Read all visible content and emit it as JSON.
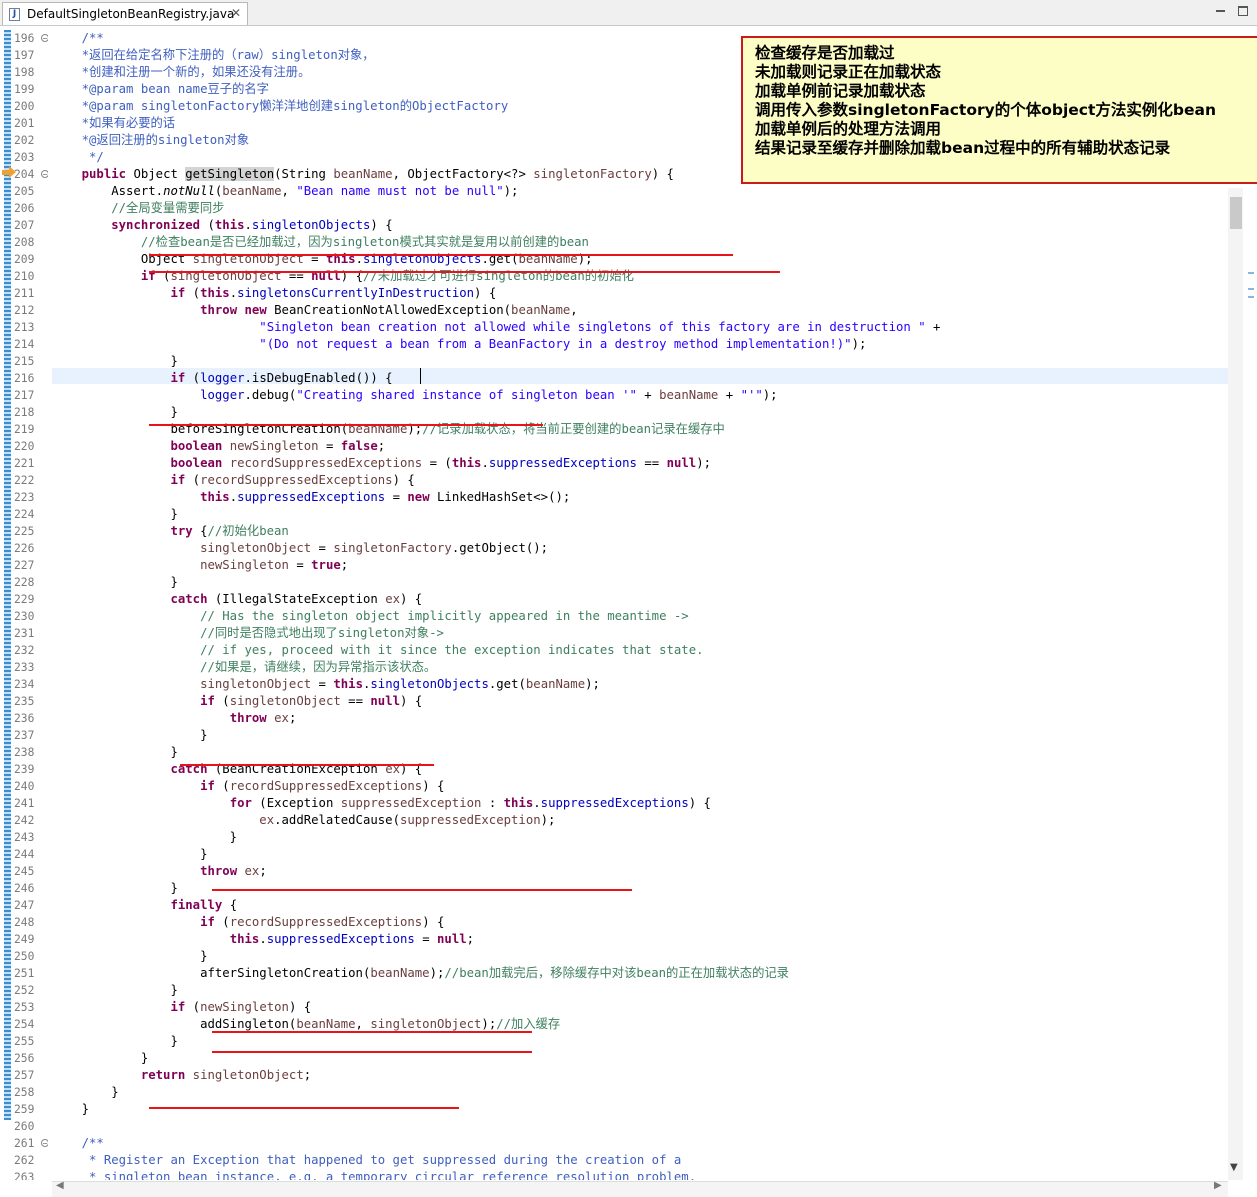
{
  "tab": {
    "icon": "java-file-icon",
    "title": "DefaultSingletonBeanRegistry.java",
    "close": "✕"
  },
  "window": {
    "minimize": "minimize-icon",
    "maximize": "maximize-icon"
  },
  "annotation": [
    "检查缓存是否加载过",
    "未加载则记录正在加载状态",
    "加载单例前记录加载状态",
    "调用传入参数singletonFactory的个体object方法实例化bean",
    "加载单例后的处理方法调用",
    "结果记录至缓存并删除加载bean过程中的所有辅助状态记录"
  ],
  "code": [
    {
      "n": "196",
      "fold": "minus",
      "t": [
        [
          "dc",
          "    /**"
        ]
      ]
    },
    {
      "n": "197",
      "t": [
        [
          "dc",
          "    *返回在给定名称下注册的（raw）singleton对象，"
        ]
      ]
    },
    {
      "n": "198",
      "t": [
        [
          "dc",
          "    *创建和注册一个新的，如果还没有注册。"
        ]
      ]
    },
    {
      "n": "199",
      "t": [
        [
          "dc",
          "    *@param bean name豆子的名字"
        ]
      ]
    },
    {
      "n": "200",
      "t": [
        [
          "dc",
          "    *@param singletonFactory懒洋洋地创建singleton的ObjectFactory"
        ]
      ]
    },
    {
      "n": "201",
      "t": [
        [
          "dc",
          "    *如果有必要的话"
        ]
      ]
    },
    {
      "n": "202",
      "t": [
        [
          "dc",
          "    *@返回注册的singleton对象"
        ]
      ]
    },
    {
      "n": "203",
      "t": [
        [
          "dc",
          "     */"
        ]
      ]
    },
    {
      "n": "204",
      "fold": "minus",
      "t": [
        [
          "",
          "    "
        ],
        [
          "kw",
          "public"
        ],
        [
          "",
          " Object "
        ],
        [
          "hl",
          "getSingleton"
        ],
        [
          "",
          "(String "
        ],
        [
          "lv",
          "beanName"
        ],
        [
          "",
          ", ObjectFactory<?> "
        ],
        [
          "lv",
          "singletonFactory"
        ],
        [
          "",
          ") {"
        ]
      ]
    },
    {
      "n": "205",
      "t": [
        [
          "",
          "        Assert."
        ],
        [
          "it",
          "notNull"
        ],
        [
          "",
          "("
        ],
        [
          "lv",
          "beanName"
        ],
        [
          "",
          ", "
        ],
        [
          "st",
          "\"Bean name must not be null\""
        ],
        [
          "",
          ");"
        ]
      ]
    },
    {
      "n": "206",
      "t": [
        [
          "cm",
          "        //全局变量需要同步"
        ]
      ]
    },
    {
      "n": "207",
      "t": [
        [
          "",
          "        "
        ],
        [
          "kw",
          "synchronized"
        ],
        [
          "",
          " ("
        ],
        [
          "kw",
          "this"
        ],
        [
          "",
          "."
        ],
        [
          "fd",
          "singletonObjects"
        ],
        [
          "",
          ") {"
        ]
      ]
    },
    {
      "n": "208",
      "t": [
        [
          "cm",
          "            //检查bean是否已经加载过，因为singleton模式其实就是复用以前创建的bean"
        ]
      ]
    },
    {
      "n": "209",
      "t": [
        [
          "",
          "            Object "
        ],
        [
          "lv",
          "singletonObject"
        ],
        [
          "",
          " = "
        ],
        [
          "kw",
          "this"
        ],
        [
          "",
          "."
        ],
        [
          "fd",
          "singletonObjects"
        ],
        [
          "",
          ".get("
        ],
        [
          "lv",
          "beanName"
        ],
        [
          "",
          ");"
        ]
      ]
    },
    {
      "n": "210",
      "t": [
        [
          "",
          "            "
        ],
        [
          "kw",
          "if"
        ],
        [
          "",
          " ("
        ],
        [
          "lv",
          "singletonObject"
        ],
        [
          "",
          " == "
        ],
        [
          "kw",
          "null"
        ],
        [
          "",
          ") {"
        ],
        [
          "cm",
          "//未加载过才可进行singleton的bean的初始化"
        ]
      ]
    },
    {
      "n": "211",
      "t": [
        [
          "",
          "                "
        ],
        [
          "kw",
          "if"
        ],
        [
          "",
          " ("
        ],
        [
          "kw",
          "this"
        ],
        [
          "",
          "."
        ],
        [
          "fd",
          "singletonsCurrentlyInDestruction"
        ],
        [
          "",
          ") {"
        ]
      ]
    },
    {
      "n": "212",
      "t": [
        [
          "",
          "                    "
        ],
        [
          "kw",
          "throw"
        ],
        [
          "",
          " "
        ],
        [
          "kw",
          "new"
        ],
        [
          "",
          " BeanCreationNotAllowedException("
        ],
        [
          "lv",
          "beanName"
        ],
        [
          "",
          ","
        ]
      ]
    },
    {
      "n": "213",
      "t": [
        [
          "",
          "                            "
        ],
        [
          "st",
          "\"Singleton bean creation not allowed while singletons of this factory are in destruction \""
        ],
        [
          "",
          " +"
        ]
      ]
    },
    {
      "n": "214",
      "t": [
        [
          "",
          "                            "
        ],
        [
          "st",
          "\"(Do not request a bean from a BeanFactory in a destroy method implementation!)\""
        ],
        [
          "",
          ");"
        ]
      ]
    },
    {
      "n": "215",
      "t": [
        [
          "",
          "                }"
        ]
      ]
    },
    {
      "n": "216",
      "t": [
        [
          "",
          "                "
        ],
        [
          "kw",
          "if"
        ],
        [
          "",
          " ("
        ],
        [
          "fd",
          "logger"
        ],
        [
          "",
          ".isDebugEnabled()) {"
        ]
      ]
    },
    {
      "n": "217",
      "t": [
        [
          "",
          "                    "
        ],
        [
          "fd",
          "logger"
        ],
        [
          "",
          ".debug("
        ],
        [
          "st",
          "\"Creating shared instance of singleton bean '\""
        ],
        [
          "",
          " + "
        ],
        [
          "lv",
          "beanName"
        ],
        [
          "",
          " + "
        ],
        [
          "st",
          "\"'\""
        ],
        [
          "",
          ");"
        ]
      ]
    },
    {
      "n": "218",
      "t": [
        [
          "",
          "                }"
        ]
      ]
    },
    {
      "n": "219",
      "t": [
        [
          "",
          "                beforeSingletonCreation("
        ],
        [
          "lv",
          "beanName"
        ],
        [
          "",
          ");"
        ],
        [
          "cm",
          "//记录加载状态，将当前正要创建的bean记录在缓存中"
        ]
      ]
    },
    {
      "n": "220",
      "t": [
        [
          "",
          "                "
        ],
        [
          "kw",
          "boolean"
        ],
        [
          "",
          " "
        ],
        [
          "lv",
          "newSingleton"
        ],
        [
          "",
          " = "
        ],
        [
          "kw",
          "false"
        ],
        [
          "",
          ";"
        ]
      ]
    },
    {
      "n": "221",
      "t": [
        [
          "",
          "                "
        ],
        [
          "kw",
          "boolean"
        ],
        [
          "",
          " "
        ],
        [
          "lv",
          "recordSuppressedExceptions"
        ],
        [
          "",
          " = ("
        ],
        [
          "kw",
          "this"
        ],
        [
          "",
          "."
        ],
        [
          "fd",
          "suppressedExceptions"
        ],
        [
          "",
          " == "
        ],
        [
          "kw",
          "null"
        ],
        [
          "",
          ");"
        ]
      ]
    },
    {
      "n": "222",
      "t": [
        [
          "",
          "                "
        ],
        [
          "kw",
          "if"
        ],
        [
          "",
          " ("
        ],
        [
          "lv",
          "recordSuppressedExceptions"
        ],
        [
          "",
          ") {"
        ]
      ]
    },
    {
      "n": "223",
      "t": [
        [
          "",
          "                    "
        ],
        [
          "kw",
          "this"
        ],
        [
          "",
          "."
        ],
        [
          "fd",
          "suppressedExceptions"
        ],
        [
          "",
          " = "
        ],
        [
          "kw",
          "new"
        ],
        [
          "",
          " LinkedHashSet<>();"
        ]
      ]
    },
    {
      "n": "224",
      "t": [
        [
          "",
          "                }"
        ]
      ]
    },
    {
      "n": "225",
      "t": [
        [
          "",
          "                "
        ],
        [
          "kw",
          "try"
        ],
        [
          "",
          " {"
        ],
        [
          "cm",
          "//初始化bean"
        ]
      ]
    },
    {
      "n": "226",
      "t": [
        [
          "",
          "                    "
        ],
        [
          "lv",
          "singletonObject"
        ],
        [
          "",
          " = "
        ],
        [
          "lv",
          "singletonFactory"
        ],
        [
          "",
          ".getObject();"
        ]
      ]
    },
    {
      "n": "227",
      "t": [
        [
          "",
          "                    "
        ],
        [
          "lv",
          "newSingleton"
        ],
        [
          "",
          " = "
        ],
        [
          "kw",
          "true"
        ],
        [
          "",
          ";"
        ]
      ]
    },
    {
      "n": "228",
      "t": [
        [
          "",
          "                }"
        ]
      ]
    },
    {
      "n": "229",
      "t": [
        [
          "",
          "                "
        ],
        [
          "kw",
          "catch"
        ],
        [
          "",
          " (IllegalStateException "
        ],
        [
          "lv",
          "ex"
        ],
        [
          "",
          ") {"
        ]
      ]
    },
    {
      "n": "230",
      "t": [
        [
          "cm",
          "                    // Has the singleton object implicitly appeared in the meantime ->"
        ]
      ]
    },
    {
      "n": "231",
      "t": [
        [
          "cm",
          "                    //同时是否隐式地出现了singleton对象->"
        ]
      ]
    },
    {
      "n": "232",
      "t": [
        [
          "cm",
          "                    // if yes, proceed with it since the exception indicates that state."
        ]
      ]
    },
    {
      "n": "233",
      "t": [
        [
          "cm",
          "                    //如果是，请继续，因为异常指示该状态。"
        ]
      ]
    },
    {
      "n": "234",
      "t": [
        [
          "",
          "                    "
        ],
        [
          "lv",
          "singletonObject"
        ],
        [
          "",
          " = "
        ],
        [
          "kw",
          "this"
        ],
        [
          "",
          "."
        ],
        [
          "fd",
          "singletonObjects"
        ],
        [
          "",
          ".get("
        ],
        [
          "lv",
          "beanName"
        ],
        [
          "",
          ");"
        ]
      ]
    },
    {
      "n": "235",
      "t": [
        [
          "",
          "                    "
        ],
        [
          "kw",
          "if"
        ],
        [
          "",
          " ("
        ],
        [
          "lv",
          "singletonObject"
        ],
        [
          "",
          " == "
        ],
        [
          "kw",
          "null"
        ],
        [
          "",
          ") {"
        ]
      ]
    },
    {
      "n": "236",
      "t": [
        [
          "",
          "                        "
        ],
        [
          "kw",
          "throw"
        ],
        [
          "",
          " "
        ],
        [
          "lv",
          "ex"
        ],
        [
          "",
          ";"
        ]
      ]
    },
    {
      "n": "237",
      "t": [
        [
          "",
          "                    }"
        ]
      ]
    },
    {
      "n": "238",
      "t": [
        [
          "",
          "                }"
        ]
      ]
    },
    {
      "n": "239",
      "t": [
        [
          "",
          "                "
        ],
        [
          "kw",
          "catch"
        ],
        [
          "",
          " (BeanCreationException "
        ],
        [
          "lv",
          "ex"
        ],
        [
          "",
          ") {"
        ]
      ]
    },
    {
      "n": "240",
      "t": [
        [
          "",
          "                    "
        ],
        [
          "kw",
          "if"
        ],
        [
          "",
          " ("
        ],
        [
          "lv",
          "recordSuppressedExceptions"
        ],
        [
          "",
          ") {"
        ]
      ]
    },
    {
      "n": "241",
      "t": [
        [
          "",
          "                        "
        ],
        [
          "kw",
          "for"
        ],
        [
          "",
          " (Exception "
        ],
        [
          "lv",
          "suppressedException"
        ],
        [
          "",
          " : "
        ],
        [
          "kw",
          "this"
        ],
        [
          "",
          "."
        ],
        [
          "fd",
          "suppressedExceptions"
        ],
        [
          "",
          ") {"
        ]
      ]
    },
    {
      "n": "242",
      "t": [
        [
          "",
          "                            "
        ],
        [
          "lv",
          "ex"
        ],
        [
          "",
          ".addRelatedCause("
        ],
        [
          "lv",
          "suppressedException"
        ],
        [
          "",
          ");"
        ]
      ]
    },
    {
      "n": "243",
      "t": [
        [
          "",
          "                        }"
        ]
      ]
    },
    {
      "n": "244",
      "t": [
        [
          "",
          "                    }"
        ]
      ]
    },
    {
      "n": "245",
      "t": [
        [
          "",
          "                    "
        ],
        [
          "kw",
          "throw"
        ],
        [
          "",
          " "
        ],
        [
          "lv",
          "ex"
        ],
        [
          "",
          ";"
        ]
      ]
    },
    {
      "n": "246",
      "t": [
        [
          "",
          "                }"
        ]
      ]
    },
    {
      "n": "247",
      "t": [
        [
          "",
          "                "
        ],
        [
          "kw",
          "finally"
        ],
        [
          "",
          " {"
        ]
      ]
    },
    {
      "n": "248",
      "t": [
        [
          "",
          "                    "
        ],
        [
          "kw",
          "if"
        ],
        [
          "",
          " ("
        ],
        [
          "lv",
          "recordSuppressedExceptions"
        ],
        [
          "",
          ") {"
        ]
      ]
    },
    {
      "n": "249",
      "t": [
        [
          "",
          "                        "
        ],
        [
          "kw",
          "this"
        ],
        [
          "",
          "."
        ],
        [
          "fd",
          "suppressedExceptions"
        ],
        [
          "",
          " = "
        ],
        [
          "kw",
          "null"
        ],
        [
          "",
          ";"
        ]
      ]
    },
    {
      "n": "250",
      "t": [
        [
          "",
          "                    }"
        ]
      ]
    },
    {
      "n": "251",
      "t": [
        [
          "",
          "                    afterSingletonCreation("
        ],
        [
          "lv",
          "beanName"
        ],
        [
          "",
          ");"
        ],
        [
          "cm",
          "//bean加载完后，移除缓存中对该bean的正在加载状态的记录"
        ]
      ]
    },
    {
      "n": "252",
      "t": [
        [
          "",
          "                }"
        ]
      ]
    },
    {
      "n": "253",
      "t": [
        [
          "",
          "                "
        ],
        [
          "kw",
          "if"
        ],
        [
          "",
          " ("
        ],
        [
          "lv",
          "newSingleton"
        ],
        [
          "",
          ") {"
        ]
      ]
    },
    {
      "n": "254",
      "t": [
        [
          "",
          "                    addSingleton("
        ],
        [
          "lv",
          "beanName"
        ],
        [
          "",
          ", "
        ],
        [
          "lv",
          "singletonObject"
        ],
        [
          "",
          ");"
        ],
        [
          "cm",
          "//加入缓存"
        ]
      ]
    },
    {
      "n": "255",
      "t": [
        [
          "",
          "                }"
        ]
      ]
    },
    {
      "n": "256",
      "t": [
        [
          "",
          "            }"
        ]
      ]
    },
    {
      "n": "257",
      "t": [
        [
          "",
          "            "
        ],
        [
          "kw",
          "return"
        ],
        [
          "",
          " "
        ],
        [
          "lv",
          "singletonObject"
        ],
        [
          "",
          ";"
        ]
      ]
    },
    {
      "n": "258",
      "t": [
        [
          "",
          "        }"
        ]
      ]
    },
    {
      "n": "259",
      "t": [
        [
          "",
          "    }"
        ]
      ]
    },
    {
      "n": "260",
      "t": [
        [
          "",
          ""
        ]
      ]
    },
    {
      "n": "261",
      "fold": "minus",
      "t": [
        [
          "dc",
          "    /**"
        ]
      ]
    },
    {
      "n": "262",
      "t": [
        [
          "dc",
          "     * Register an Exception that happened to get suppressed during the creation of a"
        ]
      ]
    },
    {
      "n": "263",
      "t": [
        [
          "dc",
          "     * singleton bean instance, e.g. a temporary circular reference resolution problem."
        ]
      ]
    }
  ]
}
